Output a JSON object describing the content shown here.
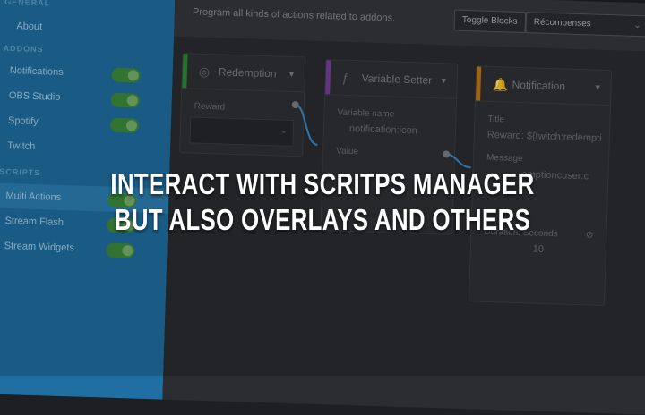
{
  "sidebar": {
    "sections": [
      {
        "title": "GENERAL",
        "items": [
          {
            "label": "About"
          }
        ]
      },
      {
        "title": "ADDONS",
        "items": [
          {
            "label": "Notifications"
          },
          {
            "label": "OBS Studio"
          },
          {
            "label": "Spotify"
          },
          {
            "label": "Twitch"
          }
        ]
      },
      {
        "title": "SCRIPTS",
        "items": [
          {
            "label": "Multi Actions"
          },
          {
            "label": "Stream Flash"
          },
          {
            "label": "Stream Widgets"
          }
        ]
      }
    ]
  },
  "topbar": {
    "description": "Program all kinds of actions related to addons.",
    "toggle_blocks": "Toggle Blocks",
    "select_value": "Récompenses",
    "add": "+"
  },
  "blocks": {
    "redemption": {
      "title": "Redemption",
      "field_label": "Reward",
      "color": "#2e8b3a"
    },
    "variable_setter": {
      "title": "Variable Setter",
      "field1_label": "Variable name",
      "field1_value": "notification:icon",
      "field2_label": "Value",
      "color": "#7b3fa0"
    },
    "notification": {
      "title": "Notification",
      "field1_label": "Title",
      "field1_value": "Reward: ${twitch:redempti",
      "field2_label": "Message",
      "field2_value": "emptioncuser:c",
      "field3_label": "Duration: Seconds",
      "field3_value": "10",
      "color": "#c07a1a"
    }
  },
  "headline": {
    "line1": "INTERACT WITH SCRITPS MANAGER",
    "line2": "BUT ALSO OVERLAYS AND OTHERS"
  }
}
